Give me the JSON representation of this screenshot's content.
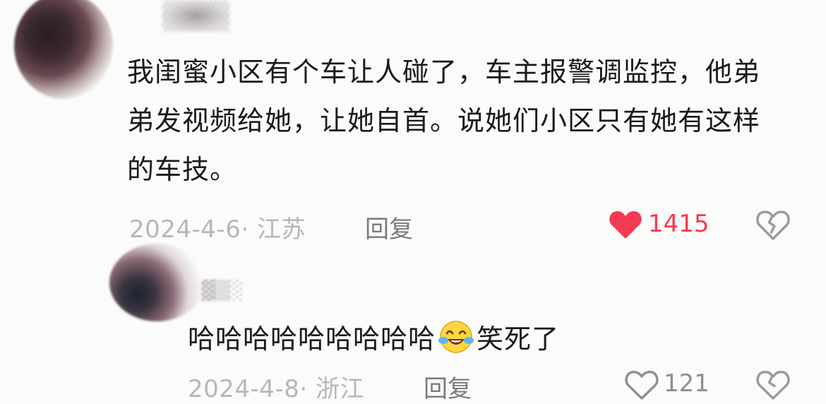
{
  "comment": {
    "text": "我闺蜜小区有个车让人碰了，车主报警调监控，他弟弟发视频给她，让她自首。说她们小区只有她有这样的车技。",
    "date_location": "2024-4-6· 江苏",
    "reply_label": "回复",
    "like_count": "1415",
    "liked": true,
    "like_icon": "heart-filled",
    "dislike_icon": "broken-heart",
    "accent_color": "#f23b53"
  },
  "reply_comment": {
    "text_before_emoji": "哈哈哈哈哈哈哈哈哈",
    "emoji": "laughing-tears-emoji",
    "text_after_emoji": "笑死了",
    "date_location": "2024-4-8· 浙江",
    "reply_label": "回复",
    "like_count": "121",
    "like_icon": "heart-outline",
    "dislike_icon": "broken-heart"
  }
}
